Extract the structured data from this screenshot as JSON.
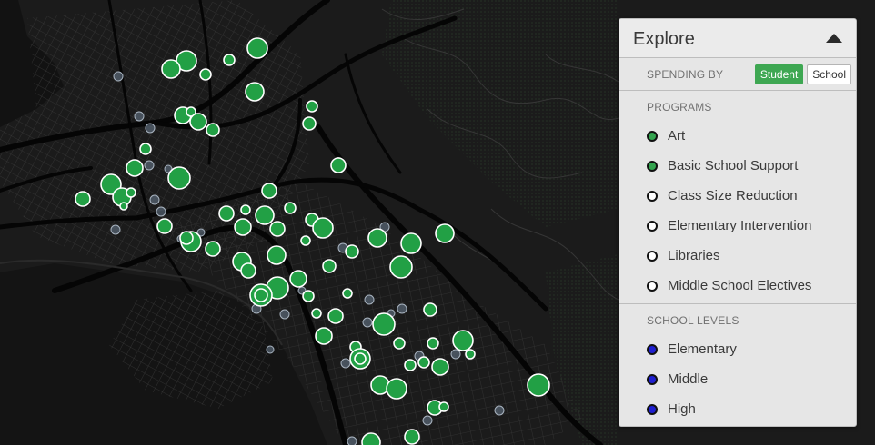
{
  "panel": {
    "title": "Explore",
    "collapse_icon": "triangle-up-icon"
  },
  "spending": {
    "label": "SPENDING BY",
    "options": [
      {
        "label": "Student",
        "active": true
      },
      {
        "label": "School",
        "active": false
      }
    ]
  },
  "programs": {
    "label": "PROGRAMS",
    "items": [
      {
        "label": "Art",
        "selected": true
      },
      {
        "label": "Basic School Support",
        "selected": true
      },
      {
        "label": "Class Size Reduction",
        "selected": false
      },
      {
        "label": "Elementary Intervention",
        "selected": false
      },
      {
        "label": "Libraries",
        "selected": false
      },
      {
        "label": "Middle School Electives",
        "selected": false
      }
    ]
  },
  "school_levels": {
    "label": "SCHOOL LEVELS",
    "items": [
      {
        "label": "Elementary",
        "selected": true
      },
      {
        "label": "Middle",
        "selected": true
      },
      {
        "label": "High",
        "selected": true
      }
    ]
  },
  "colors": {
    "map_background": "#1b1b1b",
    "road": "#000000",
    "street": "#3a3a3a",
    "school_marker_green": "#22a045",
    "school_marker_inactive": "#5a6878",
    "accent_green": "#3ea752",
    "level_blue": "#1f1fd0"
  }
}
